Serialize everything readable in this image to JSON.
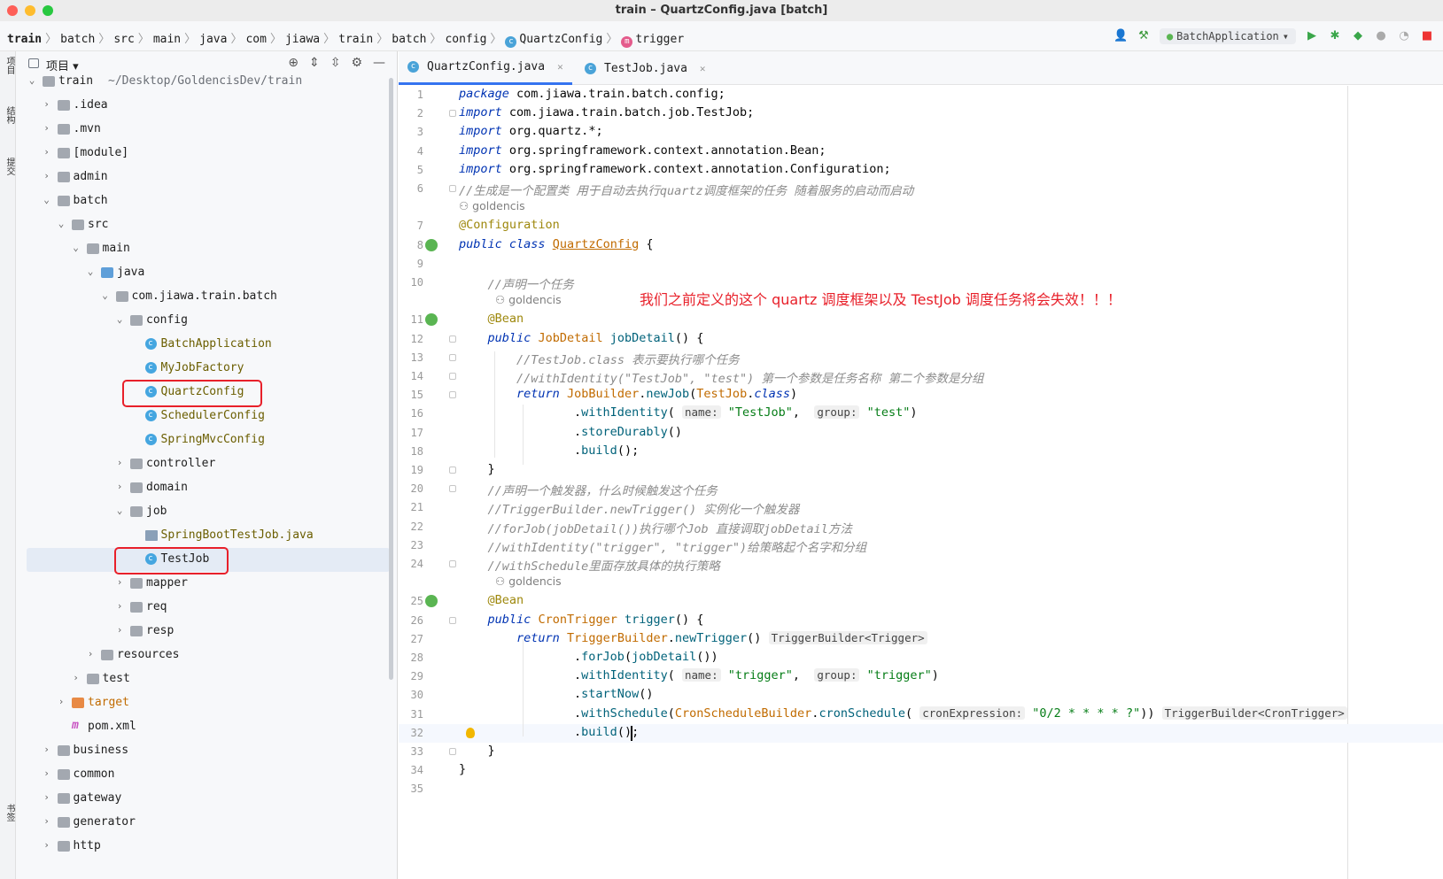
{
  "window": {
    "title": "train – QuartzConfig.java [batch]"
  },
  "breadcrumbs": [
    "train",
    "batch",
    "src",
    "main",
    "java",
    "com",
    "jiawa",
    "train",
    "batch",
    "config",
    "QuartzConfig",
    "trigger"
  ],
  "toolbar": {
    "run_config": "BatchApplication"
  },
  "stripe": {
    "project": "项目",
    "structure": "结构",
    "commit": "提交",
    "bookmarks": "书签"
  },
  "project_panel": {
    "title": "项目",
    "tree": [
      {
        "label": "train",
        "suffix": "~/Desktop/GoldencisDev/train",
        "depth": 0,
        "icon": "folder",
        "open": true
      },
      {
        "label": ".idea",
        "depth": 1,
        "icon": "folder",
        "open": false
      },
      {
        "label": ".mvn",
        "depth": 1,
        "icon": "folder",
        "open": false
      },
      {
        "label": "[module]",
        "depth": 1,
        "icon": "folder",
        "open": false
      },
      {
        "label": "admin",
        "depth": 1,
        "icon": "folder",
        "open": false
      },
      {
        "label": "batch",
        "depth": 1,
        "icon": "folder",
        "open": true
      },
      {
        "label": "src",
        "depth": 2,
        "icon": "folder",
        "open": true
      },
      {
        "label": "main",
        "depth": 3,
        "icon": "folder",
        "open": true
      },
      {
        "label": "java",
        "depth": 4,
        "icon": "folder-blue",
        "open": true
      },
      {
        "label": "com.jiawa.train.batch",
        "depth": 5,
        "icon": "pkg",
        "open": true
      },
      {
        "label": "config",
        "depth": 6,
        "icon": "pkg",
        "open": true
      },
      {
        "label": "BatchApplication",
        "depth": 7,
        "icon": "cls",
        "leaf": true
      },
      {
        "label": "MyJobFactory",
        "depth": 7,
        "icon": "cls",
        "leaf": true
      },
      {
        "label": "QuartzConfig",
        "depth": 7,
        "icon": "cls",
        "leaf": true
      },
      {
        "label": "SchedulerConfig",
        "depth": 7,
        "icon": "cls",
        "leaf": true
      },
      {
        "label": "SpringMvcConfig",
        "depth": 7,
        "icon": "cls",
        "leaf": true
      },
      {
        "label": "controller",
        "depth": 6,
        "icon": "pkg",
        "open": false
      },
      {
        "label": "domain",
        "depth": 6,
        "icon": "pkg",
        "open": false
      },
      {
        "label": "job",
        "depth": 6,
        "icon": "pkg",
        "open": true
      },
      {
        "label": "SpringBootTestJob.java",
        "depth": 7,
        "icon": "javafile",
        "leaf": true
      },
      {
        "label": "TestJob",
        "depth": 7,
        "icon": "cls",
        "leaf": true,
        "selected": true
      },
      {
        "label": "mapper",
        "depth": 6,
        "icon": "pkg",
        "open": false
      },
      {
        "label": "req",
        "depth": 6,
        "icon": "pkg",
        "open": false
      },
      {
        "label": "resp",
        "depth": 6,
        "icon": "pkg",
        "open": false
      },
      {
        "label": "resources",
        "depth": 4,
        "icon": "folder",
        "open": false
      },
      {
        "label": "test",
        "depth": 3,
        "icon": "folder",
        "open": false
      },
      {
        "label": "target",
        "depth": 2,
        "icon": "folder-orange",
        "open": false
      },
      {
        "label": "pom.xml",
        "depth": 2,
        "icon": "mvn",
        "leaf": true
      },
      {
        "label": "business",
        "depth": 1,
        "icon": "folder",
        "open": false
      },
      {
        "label": "common",
        "depth": 1,
        "icon": "folder",
        "open": false
      },
      {
        "label": "gateway",
        "depth": 1,
        "icon": "folder",
        "open": false
      },
      {
        "label": "generator",
        "depth": 1,
        "icon": "folder",
        "open": false
      },
      {
        "label": "http",
        "depth": 1,
        "icon": "folder",
        "open": false
      }
    ]
  },
  "tabs": [
    {
      "label": "QuartzConfig.java",
      "active": true
    },
    {
      "label": "TestJob.java",
      "active": false
    }
  ],
  "editor": {
    "annotation": "我们之前定义的这个 quartz 调度框架以及 TestJob 调度任务将会失效！！！",
    "author": "goldencis",
    "lines": [
      {
        "n": "1",
        "html": "<span class='kw'>package</span> com.jiawa.train.batch.config;"
      },
      {
        "n": "2",
        "html": "<span class='kw'>import</span> com.jiawa.train.batch.job.TestJob;"
      },
      {
        "n": "3",
        "html": "<span class='kw'>import</span> org.quartz.*;"
      },
      {
        "n": "4",
        "html": "<span class='kw'>import</span> org.springframework.context.annotation.Bean;"
      },
      {
        "n": "5",
        "html": "<span class='kw'>import</span> org.springframework.context.annotation.Configuration;"
      },
      {
        "n": "6",
        "html": "<span class='cm'>//生成是一个配置类 用于自动去执行quartz调度框架的任务 随着服务的启动而启动</span>"
      },
      {
        "n": "",
        "author": true,
        "indent": 0
      },
      {
        "n": "7",
        "html": "<span class='an'>@Configuration</span>"
      },
      {
        "n": "8",
        "html": "<span class='kw'>public class</span> <span class='cl' style='text-decoration:underline'>QuartzConfig</span> {"
      },
      {
        "n": "9",
        "html": ""
      },
      {
        "n": "10",
        "html": "    <span class='cm'>//声明一个任务</span>"
      },
      {
        "n": "",
        "author": true,
        "indent": 1
      },
      {
        "n": "11",
        "html": "    <span class='an'>@Bean</span>"
      },
      {
        "n": "12",
        "html": "    <span class='kw'>public</span> <span class='cl'>JobDetail</span> <span class='me'>jobDetail</span>() {"
      },
      {
        "n": "13",
        "html": "        <span class='cm'>//TestJob.class 表示要执行哪个任务</span>"
      },
      {
        "n": "14",
        "html": "        <span class='cm'>//withIdentity(\"TestJob\", \"test\") 第一个参数是任务名称 第二个参数是分组</span>"
      },
      {
        "n": "15",
        "html": "        <span class='kw'>return</span> <span class='cl'>JobBuilder</span>.<span class='me'>newJob</span>(<span class='cl'>TestJob</span>.<span class='kw'>class</span>)"
      },
      {
        "n": "16",
        "html": "                .<span class='me'>withIdentity</span>( <span class='hint'>name:</span> <span class='str'>\"TestJob\"</span>,  <span class='hint'>group:</span> <span class='str'>\"test\"</span>)"
      },
      {
        "n": "17",
        "html": "                .<span class='me'>storeDurably</span>()"
      },
      {
        "n": "18",
        "html": "                .<span class='me'>build</span>();"
      },
      {
        "n": "19",
        "html": "    }"
      },
      {
        "n": "20",
        "html": "    <span class='cm'>//声明一个触发器，什么时候触发这个任务</span>"
      },
      {
        "n": "21",
        "html": "    <span class='cm'>//TriggerBuilder.newTrigger() 实例化一个触发器</span>"
      },
      {
        "n": "22",
        "html": "    <span class='cm'>//forJob(jobDetail())执行哪个Job 直接调取jobDetail方法</span>"
      },
      {
        "n": "23",
        "html": "    <span class='cm'>//withIdentity(\"trigger\", \"trigger\")给策略起个名字和分组</span>"
      },
      {
        "n": "24",
        "html": "    <span class='cm'>//withSchedule里面存放具体的执行策略</span>"
      },
      {
        "n": "",
        "author": true,
        "indent": 1
      },
      {
        "n": "25",
        "html": "    <span class='an'>@Bean</span>"
      },
      {
        "n": "26",
        "html": "    <span class='kw'>public</span> <span class='cl'>CronTrigger</span> <span class='me'>trigger</span>() {"
      },
      {
        "n": "27",
        "html": "        <span class='kw'>return</span> <span class='cl'>TriggerBuilder</span>.<span class='me'>newTrigger</span>() <span class='hint'>TriggerBuilder&lt;Trigger&gt;</span>"
      },
      {
        "n": "28",
        "html": "                .<span class='me'>forJob</span>(<span class='me'>jobDetail</span>())"
      },
      {
        "n": "29",
        "html": "                .<span class='me'>withIdentity</span>( <span class='hint'>name:</span> <span class='str'>\"trigger\"</span>,  <span class='hint'>group:</span> <span class='str'>\"trigger\"</span>)"
      },
      {
        "n": "30",
        "html": "                .<span class='me'>startNow</span>()"
      },
      {
        "n": "31",
        "html": "                .<span class='me'>withSchedule</span>(<span class='cl'>CronScheduleBuilder</span>.<span class='me'>cronSchedule</span>( <span class='hint'>cronExpression:</span> <span class='str'>\"0/2 * * * * ?\"</span>)) <span class='hint'>TriggerBuilder&lt;CronTrigger&gt;</span>"
      },
      {
        "n": "32",
        "html": "                .<span class='me'>build</span>();",
        "current": true
      },
      {
        "n": "33",
        "html": "    }"
      },
      {
        "n": "34",
        "html": "}"
      },
      {
        "n": "35",
        "html": ""
      }
    ]
  }
}
